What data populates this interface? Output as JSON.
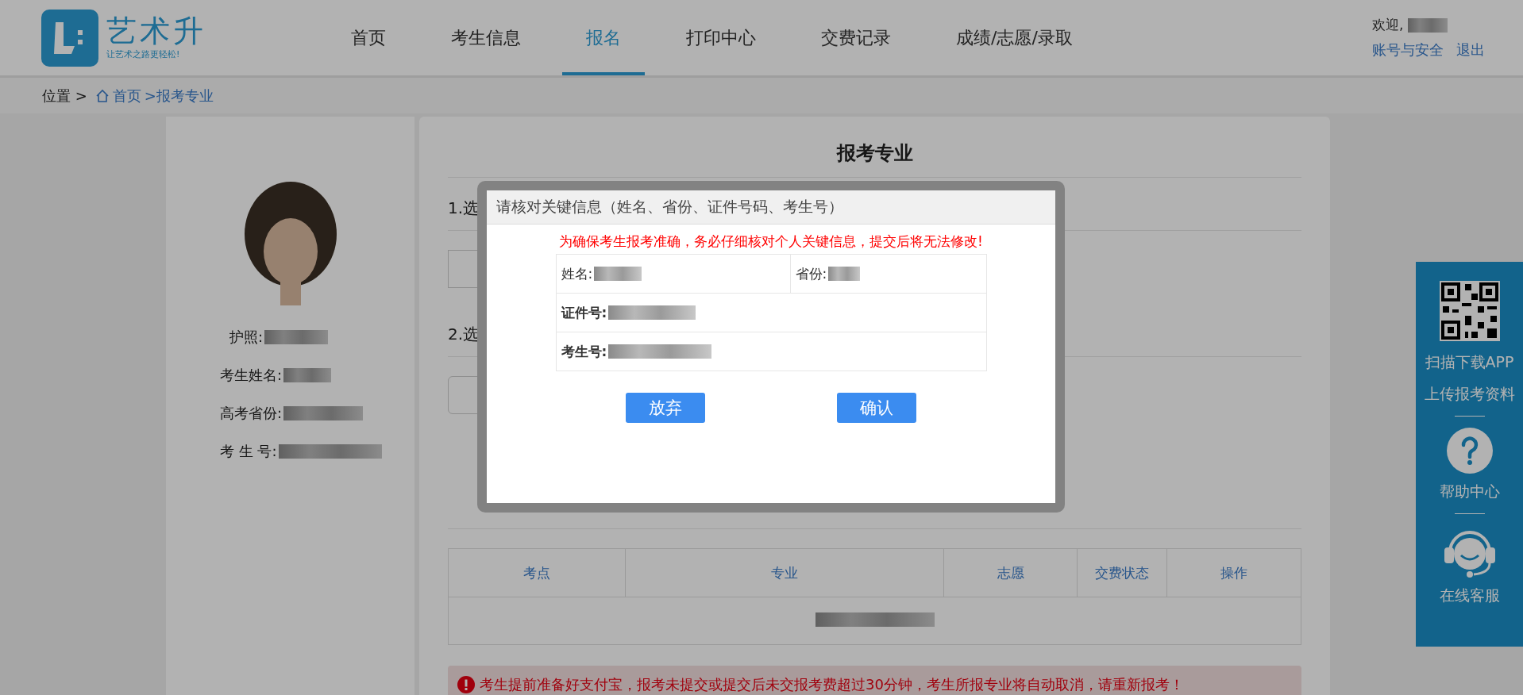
{
  "header": {
    "logo": {
      "name": "艺术升",
      "slogan": "让艺术之路更轻松!"
    },
    "nav": [
      {
        "label": "首页",
        "selected": false
      },
      {
        "label": "考生信息",
        "selected": false
      },
      {
        "label": "报名",
        "selected": true
      },
      {
        "label": "打印中心",
        "selected": false
      },
      {
        "label": "交费记录",
        "selected": false
      },
      {
        "label": "成绩/志愿/录取",
        "selected": false
      }
    ],
    "welcome": "欢迎,",
    "links": [
      "账号与安全",
      "退出"
    ]
  },
  "breadcrumb": {
    "prefix": "位置 >",
    "items": [
      "首页",
      ">报考专业"
    ]
  },
  "profile": {
    "fields": [
      "护照:",
      "考生姓名:",
      "高考省份:",
      "考 生 号:"
    ]
  },
  "main": {
    "title": "报考专业",
    "steps": [
      "1.选",
      "2.选"
    ],
    "table": {
      "columns": [
        "考点",
        "专业",
        "志愿",
        "交费状态",
        "操作"
      ]
    },
    "alert": "考生提前准备好支付宝，报考未提交或提交后未交报考费超过30分钟，考生所报专业将自动取消，请重新报考！"
  },
  "sidebar": {
    "items": [
      {
        "kind": "qr",
        "label": "扫描下载APP"
      },
      {
        "kind": "text",
        "label": "上传报考资料"
      },
      {
        "kind": "help",
        "label": "帮助中心"
      },
      {
        "kind": "service",
        "label": "在线客服"
      }
    ]
  },
  "modal": {
    "title": "请核对关键信息（姓名、省份、证件号码、考生号）",
    "warning": "为确保考生报考准确，务必仔细核对个人关键信息，提交后将无法修改!",
    "rows": [
      [
        {
          "label": "姓名:",
          "bold": false
        },
        {
          "label": "省份:",
          "bold": false
        }
      ],
      [
        {
          "label": "证件号:",
          "bold": true
        }
      ],
      [
        {
          "label": "考生号:",
          "bold": true
        }
      ]
    ],
    "buttons": [
      "放弃",
      "确认"
    ]
  }
}
